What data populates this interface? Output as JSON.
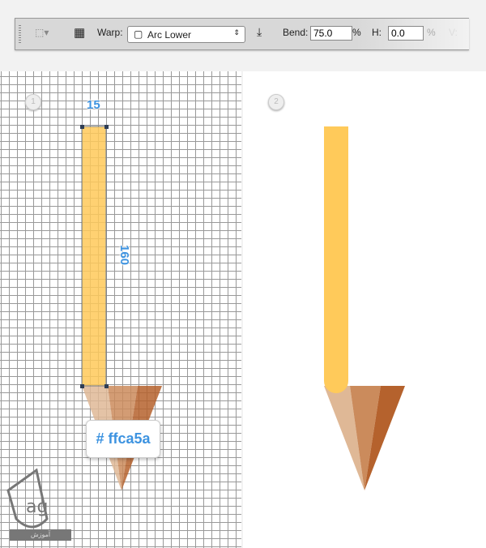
{
  "toolbar": {
    "warp_label": "Warp:",
    "warp_value": "Arc Lower",
    "bend_label": "Bend:",
    "bend_value": "75.0",
    "bend_unit": "%",
    "h_label": "H:",
    "h_value": "0.0",
    "h_unit": "%",
    "v_label": "V:"
  },
  "steps": [
    "1",
    "2"
  ],
  "dimensions": {
    "width": "15",
    "height": "160"
  },
  "color_tooltip": "# ffca5a",
  "colors": {
    "body": "#ffca5a",
    "tip_light": "#dfb896",
    "tip_mid": "#cb8b5c",
    "tip_dark": "#b5622d",
    "dimension_text": "#3d93e0"
  },
  "logo_text": "آموزش گستر افزار"
}
